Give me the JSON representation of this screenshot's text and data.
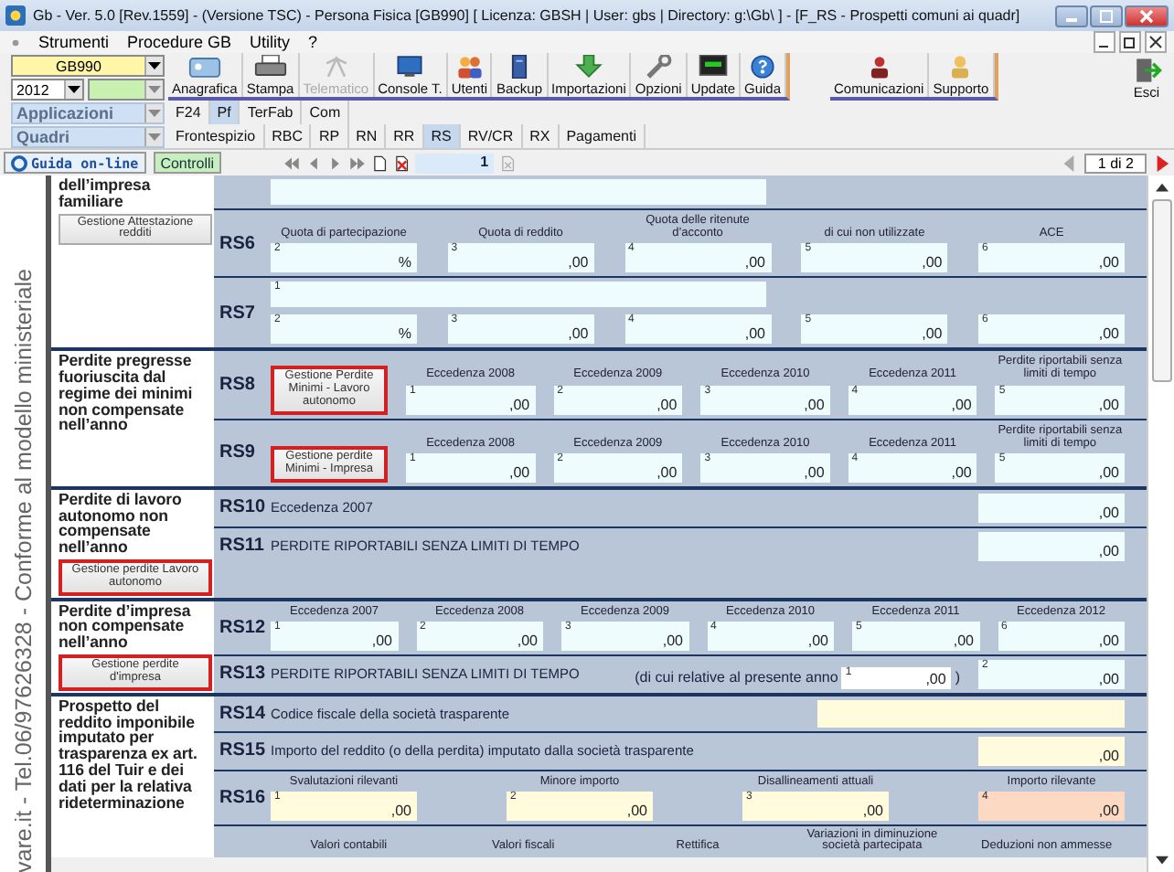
{
  "window": {
    "title": "Gb - Ver. 5.0 [Rev.1559] - (Versione TSC) -  Persona Fisica [GB990]     [ Licenza: GBSH | User: gbs | Directory: g:\\Gb\\ ] - [F_RS - Prospetti comuni ai quadr]"
  },
  "menu": [
    "Strumenti",
    "Procedure GB",
    "Utility",
    "?"
  ],
  "selectors": {
    "code": "GB990",
    "year": "2012",
    "applications": "Applicazioni",
    "quadri": "Quadri"
  },
  "toolbar": [
    {
      "label": "Anagrafica",
      "disabled": false
    },
    {
      "label": "Stampa",
      "disabled": false
    },
    {
      "label": "Telematico",
      "disabled": true
    },
    {
      "label": "Console T.",
      "disabled": false
    },
    {
      "label": "Utenti",
      "disabled": false
    },
    {
      "label": "Backup",
      "disabled": false
    },
    {
      "label": "Importazioni",
      "disabled": false
    },
    {
      "label": "Opzioni",
      "disabled": false
    },
    {
      "label": "Update",
      "disabled": false
    },
    {
      "label": "Guida",
      "disabled": false
    }
  ],
  "toolbar_right": [
    "Comunicazioni",
    "Supporto"
  ],
  "exit": "Esci",
  "app_tabs": [
    {
      "label": "F24",
      "selected": false
    },
    {
      "label": "Pf",
      "selected": true
    },
    {
      "label": "TerFab",
      "selected": false
    },
    {
      "label": "Com",
      "selected": false
    }
  ],
  "quadri_tabs": [
    {
      "label": "Frontespizio",
      "selected": false
    },
    {
      "label": "RBC",
      "selected": false
    },
    {
      "label": "RP",
      "selected": false
    },
    {
      "label": "RN",
      "selected": false
    },
    {
      "label": "RR",
      "selected": false
    },
    {
      "label": "RS",
      "selected": true
    },
    {
      "label": "RV/CR",
      "selected": false
    },
    {
      "label": "RX",
      "selected": false
    },
    {
      "label": "Pagamenti",
      "selected": false
    }
  ],
  "nav": {
    "help": "Guida on-line",
    "checks": "Controlli",
    "page": "1",
    "pages": "1 di 2"
  },
  "side_text": "vare.it - Tel.06/97626328 - Conforme al modello ministeriale",
  "sections": [
    {
      "label": "dell’impresa familiare",
      "button": {
        "label": "Gestione Attestazione redditi",
        "highlighted": false
      },
      "rows": [
        {
          "lines": [
            [
              {
                "kind": "wide",
                "color": "#eefcfe"
              }
            ]
          ]
        },
        {
          "code": "RS6",
          "lines": [
            [
              {
                "kind": "field",
                "caption": "Quota di partecipazione",
                "num": "2",
                "value": "%",
                "color": "#eefcfe"
              },
              {
                "kind": "field",
                "caption": "Quota di reddito",
                "num": "3",
                "value": ",00",
                "color": "#eefcfe"
              },
              {
                "kind": "field",
                "caption": "Quota delle ritenute d’acconto",
                "num": "4",
                "value": ",00",
                "color": "#eefcfe"
              },
              {
                "kind": "field",
                "caption": "di cui non utilizzate",
                "num": "5",
                "value": ",00",
                "color": "#eefcfe"
              },
              {
                "kind": "field",
                "caption": "ACE",
                "num": "6",
                "value": ",00",
                "color": "#eefcfe"
              }
            ]
          ]
        },
        {
          "code": "RS7",
          "lines": [
            [
              {
                "kind": "wide",
                "num": "1",
                "color": "#eefcfe"
              }
            ],
            [
              {
                "kind": "field",
                "num": "2",
                "value": "%",
                "color": "#eefcfe"
              },
              {
                "kind": "field",
                "num": "3",
                "value": ",00",
                "color": "#eefcfe"
              },
              {
                "kind": "field",
                "num": "4",
                "value": ",00",
                "color": "#eefcfe"
              },
              {
                "kind": "field",
                "num": "5",
                "value": ",00",
                "color": "#eefcfe"
              },
              {
                "kind": "field",
                "num": "6",
                "value": ",00",
                "color": "#eefcfe"
              }
            ]
          ]
        }
      ]
    },
    {
      "label": "Perdite pregresse fuoriuscita dal regime dei minimi non compensate nell’anno",
      "rows": [
        {
          "code": "RS8",
          "lines": [
            [
              {
                "kind": "button",
                "label": "Gestione Perdite Minimi - Lavoro autonomo",
                "highlighted": true
              },
              {
                "kind": "field",
                "caption": "Eccedenza 2008",
                "num": "1",
                "value": ",00",
                "color": "#eefcfe"
              },
              {
                "kind": "field",
                "caption": "Eccedenza 2009",
                "num": "2",
                "value": ",00",
                "color": "#eefcfe"
              },
              {
                "kind": "field",
                "caption": "Eccedenza 2010",
                "num": "3",
                "value": ",00",
                "color": "#eefcfe"
              },
              {
                "kind": "field",
                "caption": "Eccedenza 2011",
                "num": "4",
                "value": ",00",
                "color": "#eefcfe"
              },
              {
                "kind": "field",
                "caption": "Perdite riportabili senza limiti di tempo",
                "num": "5",
                "value": ",00",
                "color": "#eefcfe"
              }
            ]
          ]
        },
        {
          "code": "RS9",
          "lines": [
            [
              {
                "kind": "button",
                "label": "Gestione perdite Minimi - Impresa",
                "highlighted": true
              },
              {
                "kind": "field",
                "caption": "Eccedenza 2008",
                "num": "1",
                "value": ",00",
                "color": "#eefcfe"
              },
              {
                "kind": "field",
                "caption": "Eccedenza 2009",
                "num": "2",
                "value": ",00",
                "color": "#eefcfe"
              },
              {
                "kind": "field",
                "caption": "Eccedenza 2010",
                "num": "3",
                "value": ",00",
                "color": "#eefcfe"
              },
              {
                "kind": "field",
                "caption": "Eccedenza 2011",
                "num": "4",
                "value": ",00",
                "color": "#eefcfe"
              },
              {
                "kind": "field",
                "caption": "Perdite riportabili senza limiti di tempo",
                "num": "5",
                "value": ",00",
                "color": "#eefcfe"
              }
            ]
          ]
        }
      ]
    },
    {
      "label": "Perdite di lavoro autonomo non compensate nell’anno",
      "button": {
        "label": "Gestione perdite Lavoro autonomo",
        "highlighted": true
      },
      "rows": [
        {
          "code": "RS10",
          "lines": [
            [
              {
                "kind": "text",
                "text": "Eccedenza 2007"
              },
              {
                "kind": "field",
                "value": ",00",
                "color": "#eefcfe"
              }
            ]
          ]
        },
        {
          "code": "RS11",
          "lines": [
            [
              {
                "kind": "text",
                "text": "PERDITE RIPORTABILI SENZA LIMITI DI TEMPO"
              },
              {
                "kind": "field",
                "value": ",00",
                "color": "#eefcfe"
              }
            ]
          ]
        }
      ]
    },
    {
      "label": "Perdite d’impresa non compensate nell’anno",
      "button": {
        "label": "Gestione perdite d'impresa",
        "highlighted": true
      },
      "rows": [
        {
          "code": "RS12",
          "lines": [
            [
              {
                "kind": "field",
                "caption": "Eccedenza 2007",
                "num": "1",
                "value": ",00",
                "color": "#eefcfe"
              },
              {
                "kind": "field",
                "caption": "Eccedenza 2008",
                "num": "2",
                "value": ",00",
                "color": "#eefcfe"
              },
              {
                "kind": "field",
                "caption": "Eccedenza 2009",
                "num": "3",
                "value": ",00",
                "color": "#eefcfe"
              },
              {
                "kind": "field",
                "caption": "Eccedenza 2010",
                "num": "4",
                "value": ",00",
                "color": "#eefcfe"
              },
              {
                "kind": "field",
                "caption": "Eccedenza 2011",
                "num": "5",
                "value": ",00",
                "color": "#eefcfe"
              },
              {
                "kind": "field",
                "caption": "Eccedenza 2012",
                "num": "6",
                "value": ",00",
                "color": "#eefcfe"
              }
            ]
          ]
        },
        {
          "code": "RS13",
          "lines": [
            [
              {
                "kind": "text",
                "text": "PERDITE RIPORTABILI SENZA LIMITI DI TEMPO"
              },
              {
                "kind": "inline",
                "text": "(di cui  relative al presente anno",
                "num": "1",
                "value": ",00",
                "close": ")",
                "color": "#ffffff"
              },
              {
                "kind": "field",
                "num": "2",
                "value": ",00",
                "color": "#eefcfe"
              }
            ]
          ]
        }
      ]
    },
    {
      "label": "Prospetto del reddito imponibile imputato per trasparenza ex art. 116 del Tuir e dei dati per la relativa rideterminazione",
      "rows": [
        {
          "code": "RS14",
          "lines": [
            [
              {
                "kind": "text",
                "text": "Codice fiscale della società trasparente"
              },
              {
                "kind": "wide",
                "color": "#fffbdc"
              }
            ]
          ]
        },
        {
          "code": "RS15",
          "lines": [
            [
              {
                "kind": "text",
                "text": "Importo del reddito (o della perdita) imputato dalla società trasparente"
              },
              {
                "kind": "field",
                "value": ",00",
                "color": "#fffbdc"
              }
            ]
          ]
        },
        {
          "code": "RS16",
          "lines": [
            [
              {
                "kind": "field",
                "caption": "Svalutazioni rilevanti",
                "num": "1",
                "value": ",00",
                "color": "#fffbdc"
              },
              {
                "kind": "field",
                "caption": "Minore importo",
                "num": "2",
                "value": ",00",
                "color": "#fffbdc"
              },
              {
                "kind": "field",
                "caption": "Disallineamenti attuali",
                "num": "3",
                "value": ",00",
                "color": "#fffbdc"
              },
              {
                "kind": "field",
                "caption": "Importo rilevante",
                "num": "4",
                "value": ",00",
                "color": "#fbd9c2"
              }
            ]
          ]
        },
        {
          "lines": [
            [
              {
                "kind": "caption",
                "text": "Valori contabili"
              },
              {
                "kind": "caption",
                "text": "Valori fiscali"
              },
              {
                "kind": "caption",
                "text": "Rettifica"
              },
              {
                "kind": "caption",
                "text": "Variazioni in diminuzione società partecipata"
              },
              {
                "kind": "caption",
                "text": "Deduzioni non ammesse"
              }
            ]
          ]
        }
      ]
    }
  ]
}
